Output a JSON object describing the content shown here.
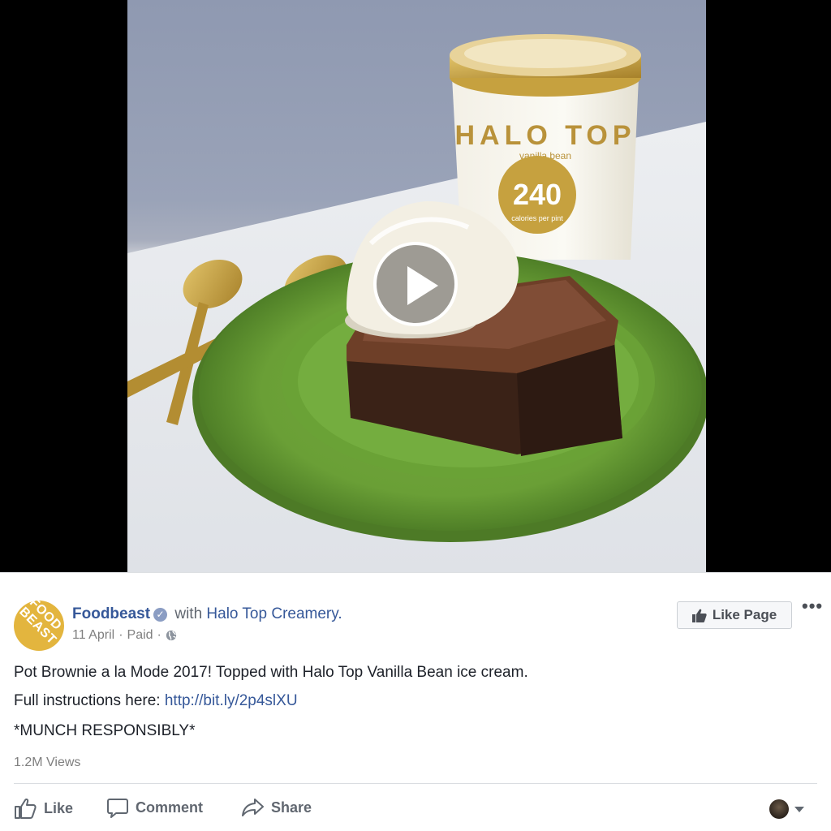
{
  "video": {
    "tub_brand": "HALO TOP",
    "tub_flavor": "vanilla bean",
    "tub_calories": "240",
    "tub_calories_sub": "calories per pint"
  },
  "post": {
    "avatar_text": "FOOD BEAST",
    "page_name": "Foodbeast",
    "with_label": "with",
    "tagged_page": "Halo Top Creamery.",
    "date": "11 April",
    "sponsored": "Paid",
    "separator": "·",
    "like_page_label": "Like Page",
    "more_label": "•••",
    "text_line1": "Pot Brownie a la Mode 2017! Topped with Halo Top Vanilla Bean ice cream.",
    "text_line2_prefix": "Full instructions here: ",
    "text_line2_link": "http://bit.ly/2p4slXU",
    "text_line3": "*MUNCH RESPONSIBLY*",
    "views": "1.2M Views"
  },
  "actions": {
    "like": "Like",
    "comment": "Comment",
    "share": "Share"
  },
  "colors": {
    "link_blue": "#365899",
    "plate_green": "#6fa33c",
    "gold": "#c9a544"
  }
}
